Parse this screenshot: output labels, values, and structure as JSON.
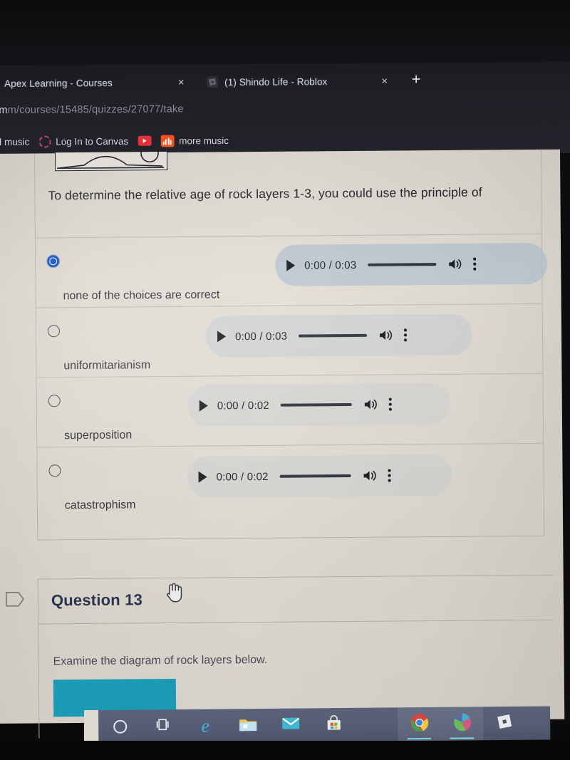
{
  "browser": {
    "tabs": [
      {
        "title": "Apex Learning - Courses",
        "favicon": "apex-icon",
        "close_label": "×"
      },
      {
        "title": "(1) Shindo Life - Roblox",
        "favicon": "roblox-icon",
        "close_label": "×"
      }
    ],
    "new_tab_label": "+",
    "url_visible": "m/courses/15485/quizzes/27077/take",
    "url_host_fragment": "m",
    "bookmarks": [
      {
        "label": "d music",
        "icon": "none"
      },
      {
        "label": "Log In to Canvas",
        "icon": "canvas-ring-icon"
      },
      {
        "label": "",
        "icon": "youtube-icon"
      },
      {
        "label": "more music",
        "icon": "soundcloud-icon"
      }
    ]
  },
  "quiz": {
    "question_text": "To determine the relative age of rock layers 1-3, you could use the principle of",
    "answers": [
      {
        "label": "none of the choices are correct",
        "selected": true,
        "audio": {
          "current": "0:00",
          "duration": "0:03",
          "time_display": "0:00 / 0:03"
        }
      },
      {
        "label": "uniformitarianism",
        "selected": false,
        "audio": {
          "current": "0:00",
          "duration": "0:03",
          "time_display": "0:00 / 0:03"
        }
      },
      {
        "label": "superposition",
        "selected": false,
        "audio": {
          "current": "0:00",
          "duration": "0:02",
          "time_display": "0:00 / 0:02"
        }
      },
      {
        "label": "catastrophism",
        "selected": false,
        "audio": {
          "current": "0:00",
          "duration": "0:02",
          "time_display": "0:00 / 0:02"
        }
      }
    ],
    "next_question": {
      "heading": "Question 13",
      "prompt": "Examine the diagram of rock layers below."
    }
  },
  "taskbar": {
    "items": [
      {
        "name": "cortana-search",
        "icon": "circle-icon",
        "active": false
      },
      {
        "name": "task-view",
        "icon": "task-view-icon",
        "active": false
      },
      {
        "name": "edge",
        "icon": "edge-icon",
        "active": false
      },
      {
        "name": "file-explorer",
        "icon": "folder-icon",
        "active": false
      },
      {
        "name": "mail",
        "icon": "envelope-icon",
        "active": false
      },
      {
        "name": "microsoft-store",
        "icon": "store-bag-icon",
        "active": false
      },
      {
        "name": "chrome",
        "icon": "chrome-icon",
        "active": true
      },
      {
        "name": "chrome-secondary",
        "icon": "chrome-alt-icon",
        "active": true
      },
      {
        "name": "roblox",
        "icon": "roblox-icon",
        "active": false
      }
    ]
  },
  "colors": {
    "selected_radio": "#0f4fc4",
    "audio_pill": "#a6bacd",
    "teal_image": "#1ba2bc",
    "question_heading": "#2b3350",
    "taskbar": "#555c73",
    "page_background": "#ded9d0"
  }
}
